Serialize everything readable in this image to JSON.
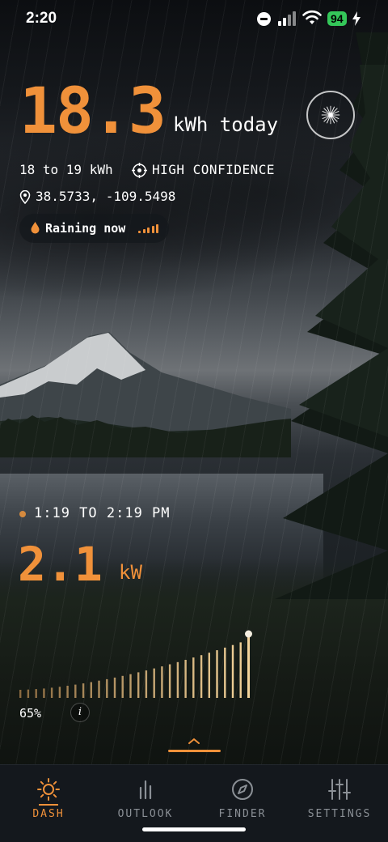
{
  "status_bar": {
    "time": "2:20",
    "battery": "94"
  },
  "hero": {
    "energy_value": "18.3",
    "energy_unit": "kWh today",
    "range": "18 to 19 kWh",
    "confidence": "HIGH CONFIDENCE",
    "coordinates": "38.5733, -109.5498"
  },
  "weather": {
    "label": "Raining now",
    "intensity_bars": 5
  },
  "window": {
    "label": "1:19 TO 2:19 PM",
    "power_value": "2.1",
    "power_unit": "kW"
  },
  "power_chart": {
    "bar_count": 30,
    "percent_label": "65%",
    "info_label": "i",
    "colors": {
      "low": "#8a6a40",
      "high": "#f3d39a",
      "marker": "#f4eee0"
    }
  },
  "tabs": [
    {
      "label": "DASH",
      "icon": "sun-icon",
      "active": true
    },
    {
      "label": "OUTLOOK",
      "icon": "bar-chart-icon",
      "active": false
    },
    {
      "label": "FINDER",
      "icon": "compass-icon",
      "active": false
    },
    {
      "label": "SETTINGS",
      "icon": "sliders-icon",
      "active": false
    }
  ],
  "colors": {
    "accent": "#f0913a",
    "tabbar_bg": "#14181d",
    "inactive_tab": "#8b9096",
    "battery": "#34c759"
  }
}
